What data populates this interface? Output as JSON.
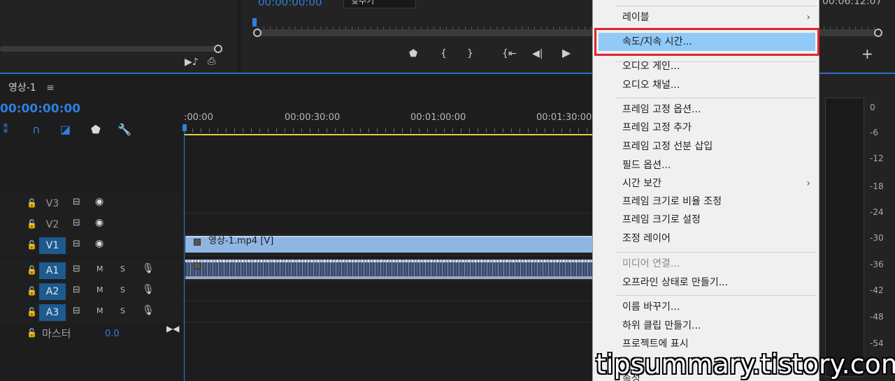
{
  "program_monitor": {
    "timecode": "00:00:00:00",
    "fit_select": "맞추기",
    "duration": "00:06:12:07"
  },
  "timeline": {
    "tab_label": "영상-1",
    "tab_menu_icon": "hamburger-icon",
    "timecode": "00:00:00:00",
    "ruler_labels": [
      ":00:00",
      "00:00:30:00",
      "00:01:00:00",
      "00:01:30:00"
    ],
    "tracks": {
      "v3": "V3",
      "v2": "V2",
      "v1": "V1",
      "a1": "A1",
      "a2": "A2",
      "a3": "A3",
      "mute": "M",
      "solo": "S"
    },
    "master_label": "마스터",
    "master_value": "0.0",
    "v1_clip_name": "영상-1.mp4 [V]"
  },
  "audio_meter": {
    "labels": [
      "0",
      "-6",
      "-12",
      "-18",
      "-24",
      "-30",
      "-36",
      "-42",
      "-48",
      "-54"
    ]
  },
  "context_menu": {
    "items": [
      {
        "label": "레이블",
        "submenu": true
      },
      {
        "label": "속도/지속 시간...",
        "highlighted": true
      },
      {
        "label": "오디오 게인..."
      },
      {
        "label": "오디오 채널..."
      },
      {
        "label": "프레임 고정 옵션..."
      },
      {
        "label": "프레임 고정 추가"
      },
      {
        "label": "프레임 고정 선분 삽입"
      },
      {
        "label": "필드 옵션..."
      },
      {
        "label": "시간 보간",
        "submenu": true
      },
      {
        "label": "프레임 크기로 비율 조정"
      },
      {
        "label": "프레임 크기로 설정"
      },
      {
        "label": "조정 레이어"
      },
      {
        "label": "미디어 연결...",
        "disabled": true
      },
      {
        "label": "오프라인 상태로 만들기..."
      },
      {
        "label": "이름 바꾸기..."
      },
      {
        "label": "하위 클립 만들기..."
      },
      {
        "label": "프로젝트에 표시"
      },
      {
        "label": "속성"
      }
    ],
    "submenu_arrow": "›"
  },
  "watermark": "tipsummary.tistory.com",
  "colors": {
    "accent_blue": "#2f7fe0",
    "highlight_red": "#e0242e",
    "menu_highlight": "#91c9f7",
    "work_area_yellow": "#e3d33a"
  }
}
